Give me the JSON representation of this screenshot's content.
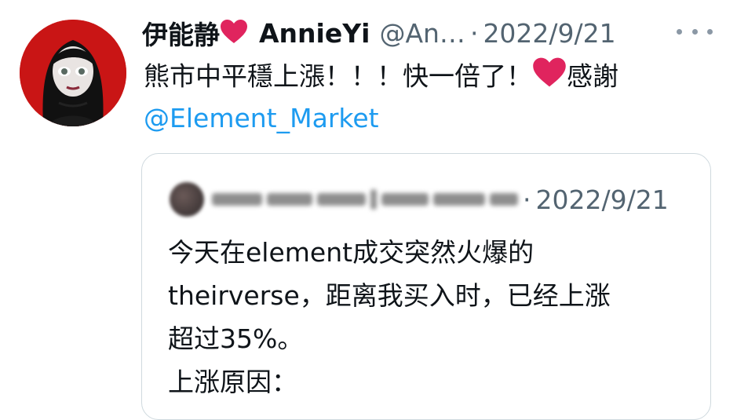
{
  "tweet": {
    "display_name": "伊能静",
    "username": "AnnieYi",
    "handle": "@An…",
    "separator": "·",
    "date": "2022/9/21",
    "text_line1_pre": "熊市中平穩上漲！！！快一倍了！",
    "text_line1_post": "感謝",
    "mention": "@Element_Market"
  },
  "quoted_tweet": {
    "separator": "·",
    "date": "2022/9/21",
    "lines": [
      "今天在element成交突然火爆的",
      "theirverse，距离我买入时，已经上涨",
      "超过35%。",
      "上涨原因："
    ]
  },
  "colors": {
    "link": "#1d9bf0",
    "secondary_text": "#536471",
    "heart": "#e0245e",
    "border": "#cfd9de"
  },
  "icons": [
    "heart-emoji-icon",
    "more-options-icon"
  ]
}
